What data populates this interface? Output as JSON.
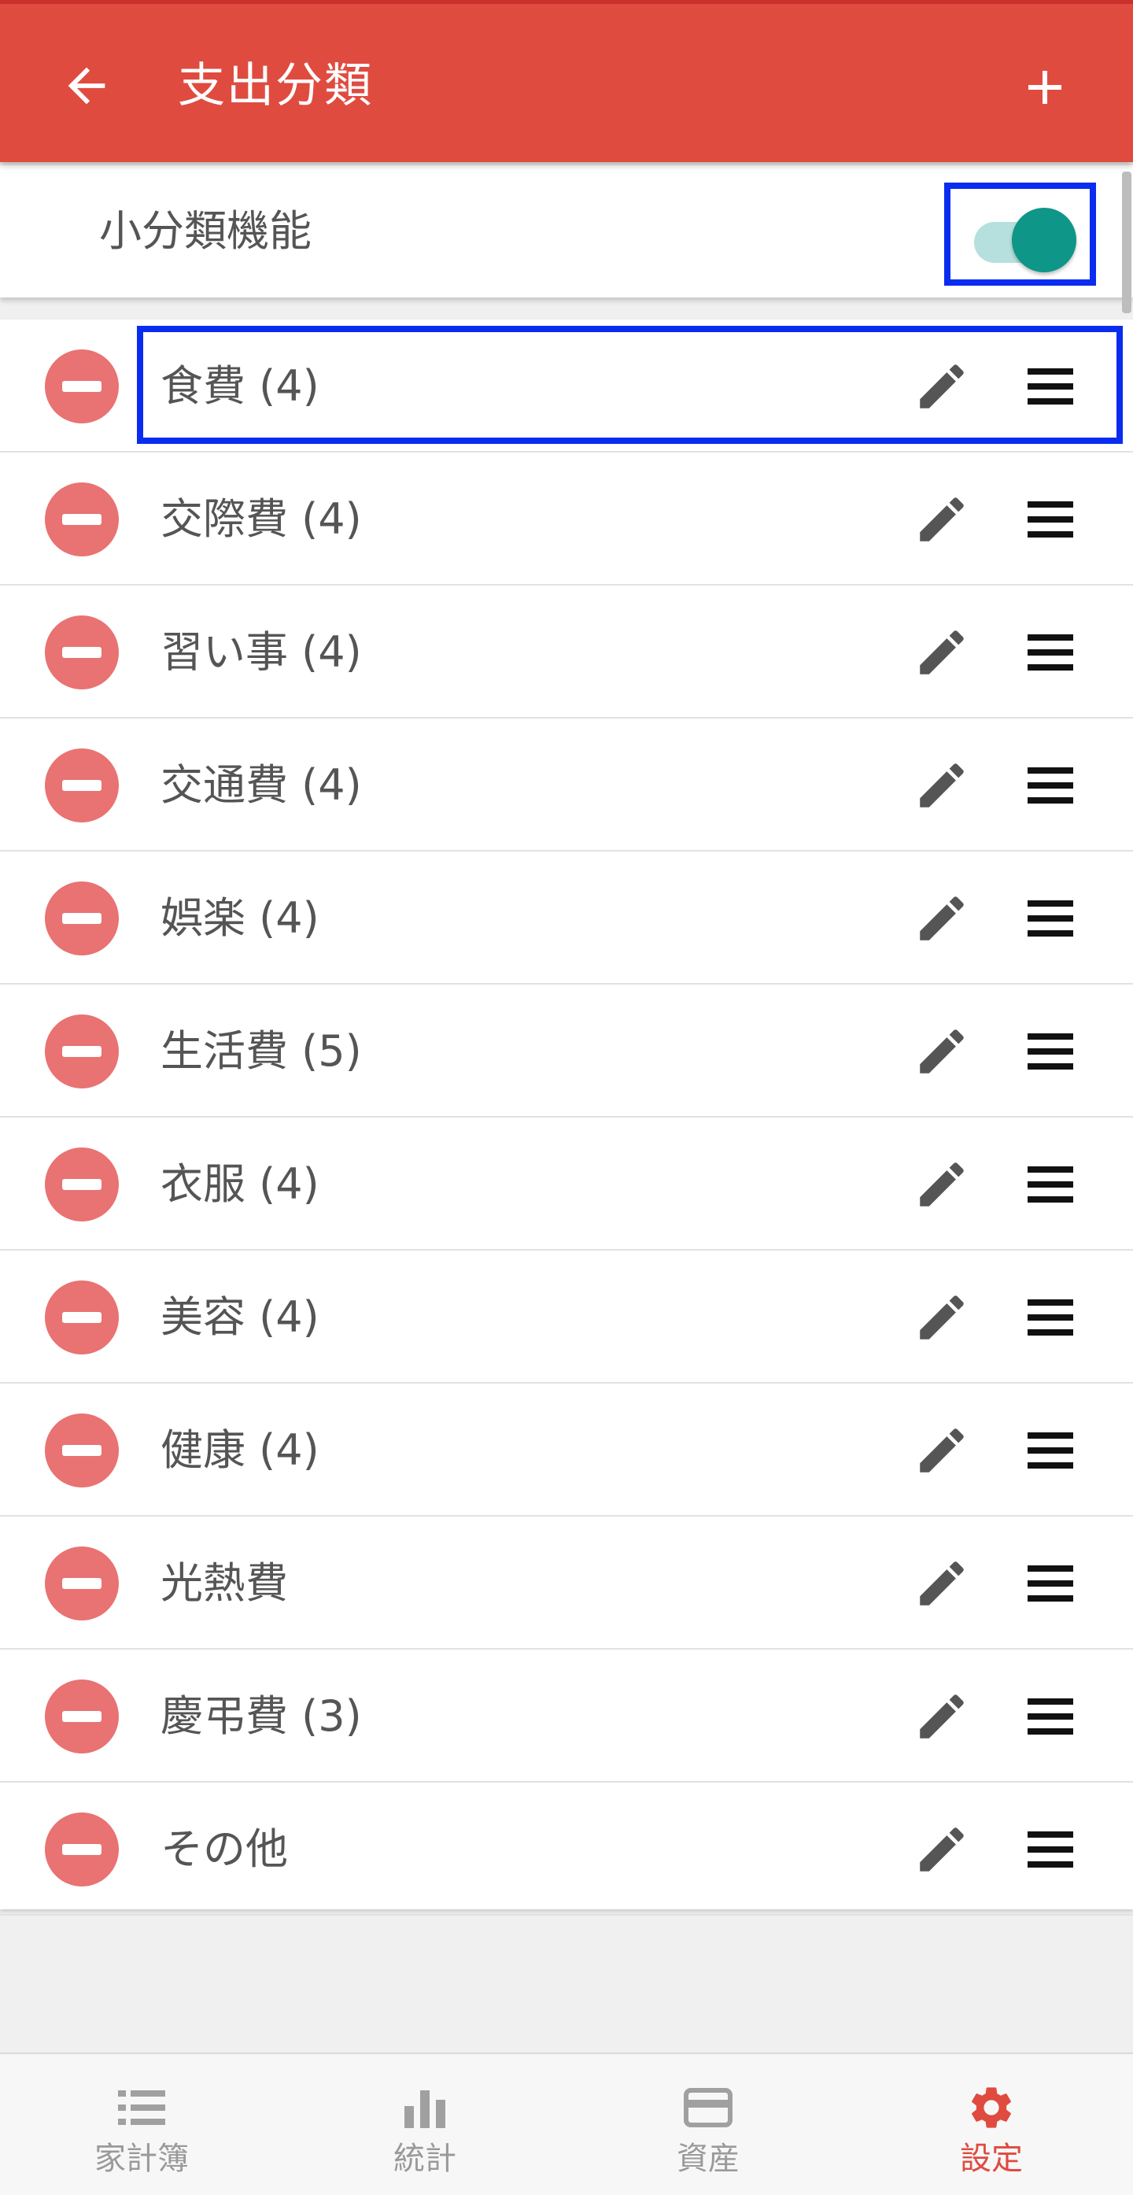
{
  "appbar": {
    "title": "支出分類",
    "back_icon": "arrow-back-icon",
    "add_icon": "plus-icon",
    "color": "#e04b40"
  },
  "feature": {
    "label": "小分類機能",
    "toggle_on": true,
    "toggle_color": "#0e9688"
  },
  "categories": [
    {
      "label": "食費 (4)"
    },
    {
      "label": "交際費 (4)"
    },
    {
      "label": "習い事 (4)"
    },
    {
      "label": "交通費 (4)"
    },
    {
      "label": "娯楽 (4)"
    },
    {
      "label": "生活費 (5)"
    },
    {
      "label": "衣服 (4)"
    },
    {
      "label": "美容 (4)"
    },
    {
      "label": "健康 (4)"
    },
    {
      "label": "光熱費"
    },
    {
      "label": "慶弔費 (3)"
    },
    {
      "label": "その他"
    }
  ],
  "row_icons": {
    "remove": "remove-circle-icon",
    "edit": "pencil-icon",
    "drag": "drag-handle-icon"
  },
  "bottom_nav": [
    {
      "label": "家計簿",
      "icon": "list-icon",
      "active": false
    },
    {
      "label": "統計",
      "icon": "bar-chart-icon",
      "active": false
    },
    {
      "label": "資産",
      "icon": "credit-card-icon",
      "active": false
    },
    {
      "label": "設定",
      "icon": "gear-icon",
      "active": true
    }
  ],
  "accent_color": "#e04b40"
}
